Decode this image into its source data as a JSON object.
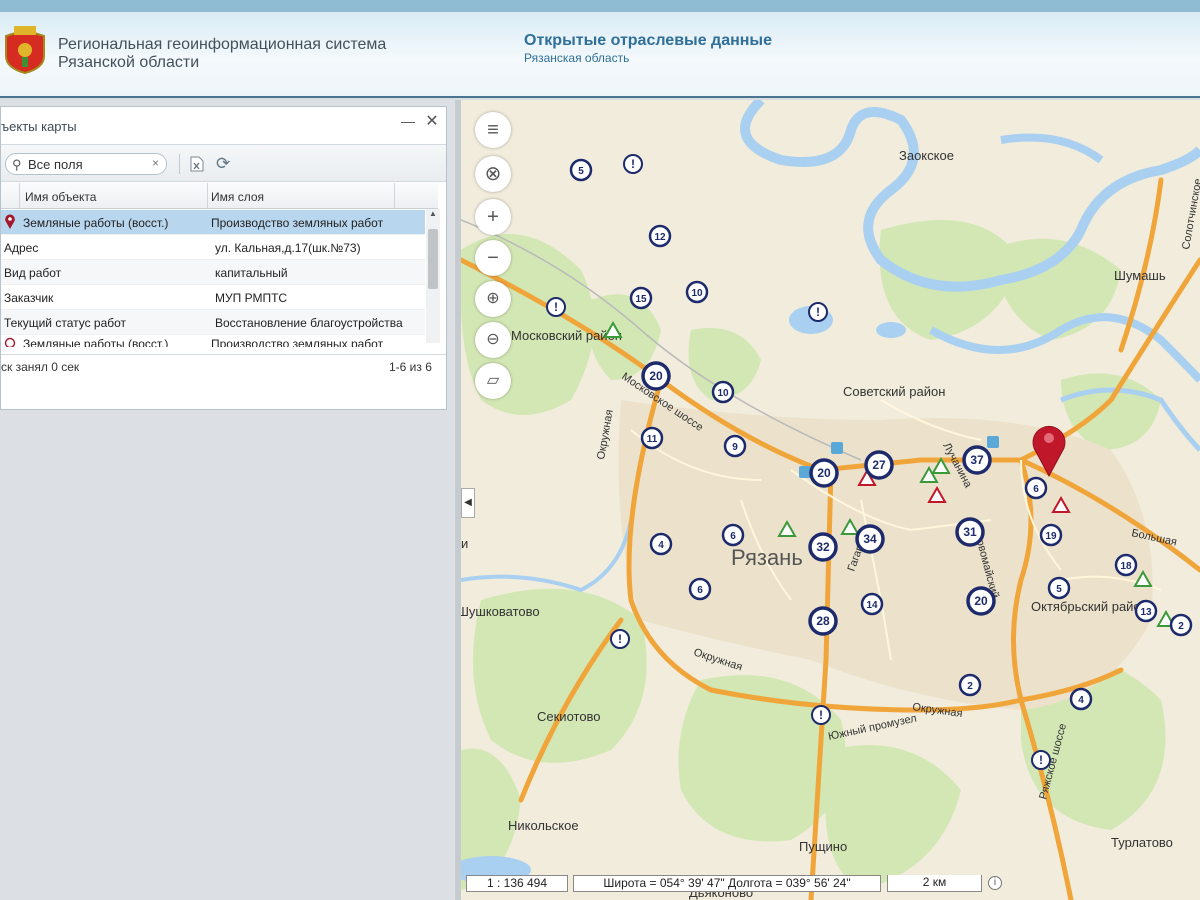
{
  "header": {
    "system_title_line1": "Региональная геоинформационная система",
    "system_title_line2": "Рязанской области",
    "portal_title": "Открытые отраслевые данные",
    "portal_subtitle": "Рязанская область"
  },
  "panel": {
    "title": "ъекты карты",
    "minimize_symbol": "—",
    "close_symbol": "✕",
    "search": {
      "value": "Все поля",
      "clear_symbol": "×"
    },
    "columns": [
      "Имя объекта",
      "Имя слоя"
    ],
    "rows": [
      {
        "name": "Земляные работы (восст.)",
        "layer": "Производство земляных работ"
      },
      {
        "name": "Адрес",
        "layer": "ул. Кальная,д.17(шк.№73)"
      },
      {
        "name": "Вид работ",
        "layer": "капитальный"
      },
      {
        "name": "Заказчик",
        "layer": "МУП РМПТС"
      },
      {
        "name": "Текущий статус работ",
        "layer": "Восстановление благоустройства"
      },
      {
        "name": "Земляные работы (восст.)",
        "layer": "Производство земляных работ"
      }
    ],
    "status_left": "ск занял 0 сек",
    "status_right": "1-6 из 6"
  },
  "map": {
    "labels": [
      "Заокское",
      "Шумашь",
      "Московский район",
      "Советский район",
      "Московское шоссе",
      "Рязань",
      "Окружная",
      "Окружная",
      "Окружная",
      "Южный промузел",
      "Октябрьский район",
      "Большая",
      "Солотчинское",
      "Лучанина",
      "Шушковатово",
      "Секиотово",
      "Никольское",
      "Пущино",
      "Турлатово",
      "Дьяконово",
      "Ряжское шоссе",
      "Гагарина",
      "Первомайский",
      "и"
    ],
    "clusters": [
      "5",
      "12",
      "15",
      "10",
      "20",
      "10",
      "11",
      "9",
      "20",
      "27",
      "37",
      "6",
      "6",
      "4",
      "6",
      "32",
      "34",
      "31",
      "19",
      "18",
      "5",
      "13",
      "2",
      "20",
      "14",
      "28",
      "2",
      "4"
    ]
  },
  "bottom": {
    "scale": "1 : 136 494",
    "coords": "Широта = 054° 39' 47\" Долгота = 039° 56' 24\"",
    "scalebar": "2 км"
  },
  "colors": {
    "accent": "#2f6f98",
    "selected_row": "#b9d6ef",
    "river": "#a9d0f0",
    "road": "#f0a53a",
    "cluster_border": "#1d2a6b",
    "marker": "#c0172b"
  }
}
